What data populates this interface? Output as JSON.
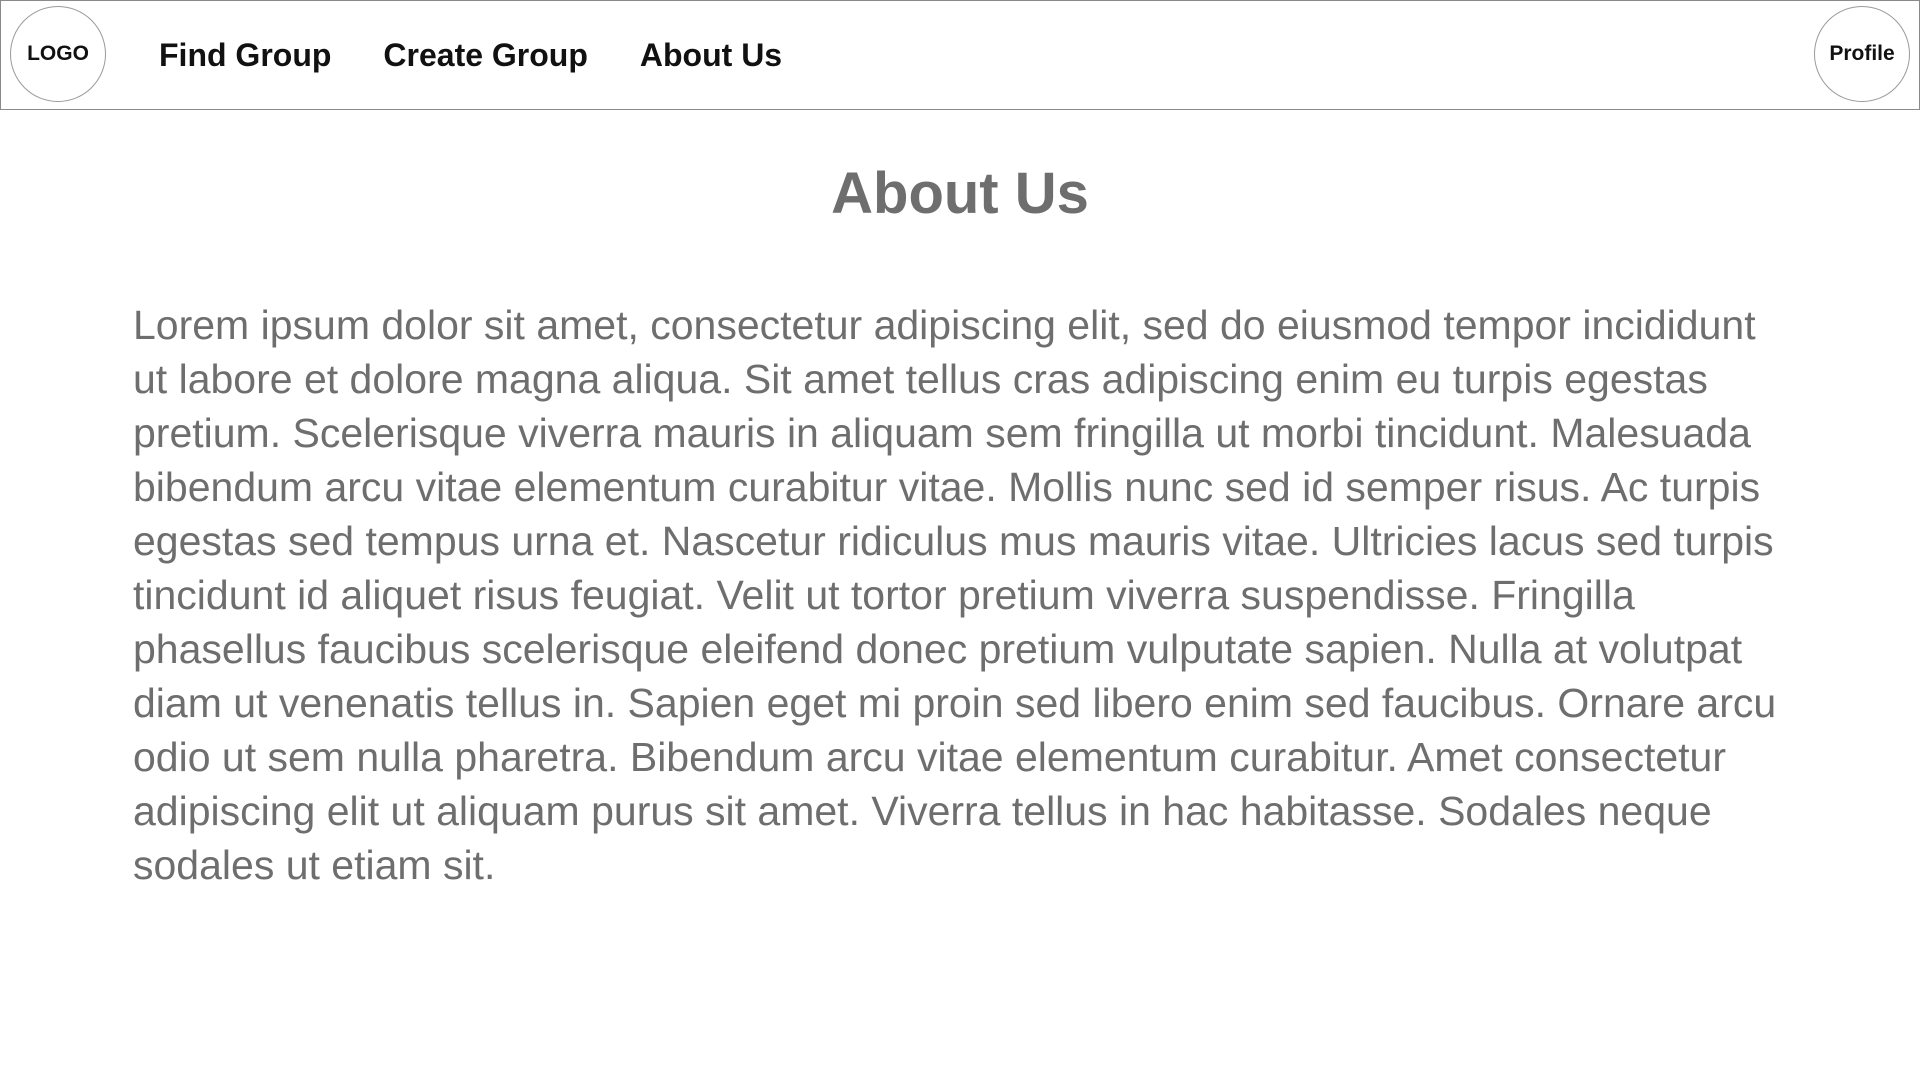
{
  "header": {
    "logo_label": "LOGO",
    "nav": [
      {
        "label": "Find Group"
      },
      {
        "label": "Create Group"
      },
      {
        "label": "About Us"
      }
    ],
    "profile_label": "Profile"
  },
  "main": {
    "title": "About Us",
    "paragraph": "Lorem ipsum dolor sit amet, consectetur adipiscing elit, sed do eiusmod tempor incididunt ut labore et dolore magna aliqua. Sit amet tellus cras adipiscing enim eu turpis egestas pretium. Scelerisque viverra mauris in aliquam sem fringilla ut morbi tincidunt. Malesuada bibendum arcu vitae elementum curabitur vitae. Mollis nunc sed id semper risus. Ac turpis egestas sed tempus urna et. Nascetur ridiculus mus mauris vitae. Ultricies lacus sed turpis tincidunt id aliquet risus feugiat. Velit ut tortor pretium viverra suspendisse. Fringilla phasellus faucibus scelerisque eleifend donec pretium vulputate sapien. Nulla at volutpat diam ut venenatis tellus in. Sapien eget mi proin sed libero enim sed faucibus. Ornare arcu odio ut sem nulla pharetra. Bibendum arcu vitae elementum curabitur. Amet consectetur adipiscing elit ut aliquam purus sit amet. Viverra tellus in hac habitasse. Sodales neque sodales ut etiam sit."
  }
}
